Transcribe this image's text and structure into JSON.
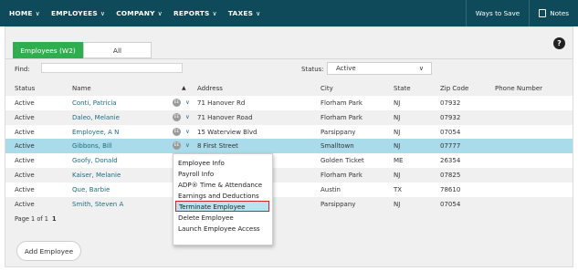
{
  "nav": {
    "items": [
      {
        "label": "HOME"
      },
      {
        "label": "EMPLOYEES"
      },
      {
        "label": "COMPANY"
      },
      {
        "label": "REPORTS"
      },
      {
        "label": "TAXES"
      }
    ],
    "ways_to_save": "Ways to Save",
    "notes": "Notes",
    "chevron": "∨"
  },
  "tabs": [
    {
      "label": "Employees (W2)",
      "active": true
    },
    {
      "label": "All",
      "active": false
    }
  ],
  "help_icon": "?",
  "filter": {
    "find_label": "Find:",
    "find_value": "",
    "status_label": "Status:",
    "status_value": "Active"
  },
  "table": {
    "headers": {
      "status": "Status",
      "name": "Name",
      "address": "Address",
      "city": "City",
      "state": "State",
      "zip": "Zip Code",
      "phone": "Phone Number"
    },
    "badge_text": "EE",
    "rows": [
      {
        "status": "Active",
        "name": "Conti, Patricia",
        "address": "71 Hanover Rd",
        "city": "Florham Park",
        "state": "NJ",
        "zip": "07932",
        "phone": ""
      },
      {
        "status": "Active",
        "name": "Daleo, Melanie",
        "address": "71 Hanover Road",
        "city": "Florham Park",
        "state": "NJ",
        "zip": "07932",
        "phone": ""
      },
      {
        "status": "Active",
        "name": "Employee, A N",
        "address": "15 Waterview Blvd",
        "city": "Parsippany",
        "state": "NJ",
        "zip": "07054",
        "phone": ""
      },
      {
        "status": "Active",
        "name": "Gibbons, Bill",
        "address": "8 First Street",
        "city": "Smalltown",
        "state": "NJ",
        "zip": "07777",
        "phone": ""
      },
      {
        "status": "Active",
        "name": "Goofy, Donald",
        "address": "",
        "city": "Golden Ticket",
        "state": "ME",
        "zip": "26354",
        "phone": ""
      },
      {
        "status": "Active",
        "name": "Kaiser, Melanie",
        "address": "",
        "city": "Florham Park",
        "state": "NJ",
        "zip": "07825",
        "phone": ""
      },
      {
        "status": "Active",
        "name": "Que, Barbie",
        "address": "",
        "city": "Austin",
        "state": "TX",
        "zip": "78610",
        "phone": ""
      },
      {
        "status": "Active",
        "name": "Smith, Steven A",
        "address": "",
        "city": "Parsippany",
        "state": "NJ",
        "zip": "07054",
        "phone": ""
      }
    ]
  },
  "pager": {
    "text": "Page 1 of 1",
    "current": "1"
  },
  "add_button": "Add Employee",
  "context_menu": {
    "items": [
      {
        "label": "Employee Info"
      },
      {
        "label": "Payroll Info"
      },
      {
        "label": "ADP® Time & Attendance"
      },
      {
        "label": "Earnings and Deductions"
      },
      {
        "label": "Terminate Employee"
      },
      {
        "label": "Delete Employee"
      },
      {
        "label": "Launch Employee Access"
      }
    ],
    "highlighted_index": 4
  },
  "colors": {
    "nav_bg": "#0f4a5a",
    "tab_active": "#2fae4f",
    "selected_row": "#a9dbea",
    "link": "#1d6d82",
    "highlight_border": "#c62828"
  }
}
